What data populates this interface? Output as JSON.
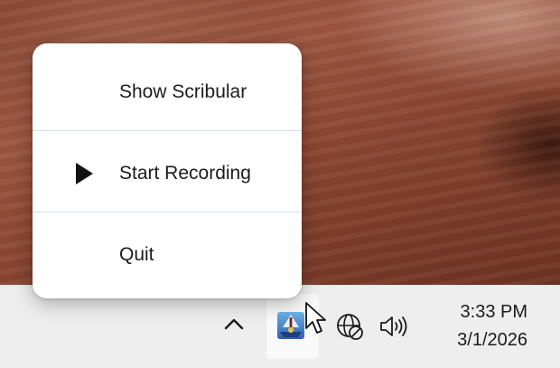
{
  "menu": {
    "items": [
      {
        "label": "Show Scribular",
        "icon": null
      },
      {
        "label": "Start Recording",
        "icon": "play-icon"
      },
      {
        "label": "Quit",
        "icon": null
      }
    ]
  },
  "tray": {
    "overflow_icon": "chevron-up-icon",
    "app_icon": "scribular-tray-icon",
    "network_icon": "globe-no-internet-icon",
    "volume_icon": "speaker-volume-icon",
    "time": "3:33 PM",
    "date": "3/1/2026"
  },
  "colors": {
    "taskbar": "#eeeeee",
    "menu_background": "#ffffff",
    "separator": "#cfe0f2",
    "text": "#1b1b1b"
  }
}
